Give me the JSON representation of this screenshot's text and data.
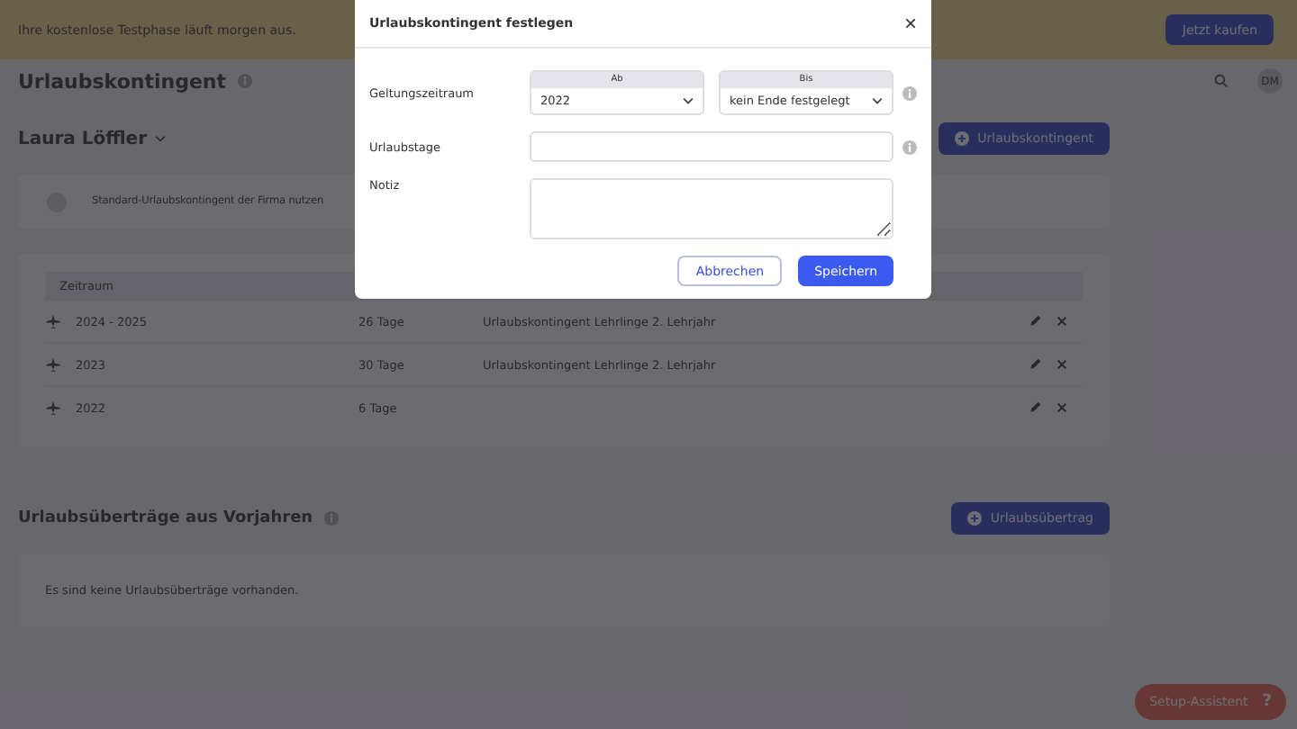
{
  "banner": {
    "text": "Ihre kostenlose Testphase läuft morgen aus.",
    "button": "Jetzt kaufen"
  },
  "header": {
    "title": "Urlaubskontingent",
    "avatar": "DM"
  },
  "employee": {
    "name": "Laura Löffler",
    "add_button": "Urlaubskontingent"
  },
  "default_option": {
    "label": "Standard-Urlaubskontingent der Firma nutzen",
    "checked": false
  },
  "table": {
    "columns": [
      "Zeitraum"
    ],
    "rows": [
      {
        "period": "2024 - 2025",
        "days": "26 Tage",
        "note": "Urlaubskontingent Lehrlinge 2. Lehrjahr"
      },
      {
        "period": "2023",
        "days": "30 Tage",
        "note": "Urlaubskontingent Lehrlinge 2. Lehrjahr"
      },
      {
        "period": "2022",
        "days": "6 Tage",
        "note": ""
      }
    ]
  },
  "carryover": {
    "title": "Urlaubsüberträge aus Vorjahren",
    "add_button": "Urlaubsübertrag",
    "empty_text": "Es sind keine Urlaubsüberträge vorhanden."
  },
  "setup_button": {
    "label": "Setup-Assistent",
    "icon_text": "?"
  },
  "dialog": {
    "title": "Urlaubskontingent festlegen",
    "close": "×",
    "period_label": "Geltungszeitraum",
    "from_label": "Ab",
    "from_value": "2022",
    "to_label": "Bis",
    "to_value": "kein Ende festgelegt",
    "days_label": "Urlaubstage",
    "note_label": "Notiz",
    "cancel": "Abbrechen",
    "save": "Speichern"
  }
}
